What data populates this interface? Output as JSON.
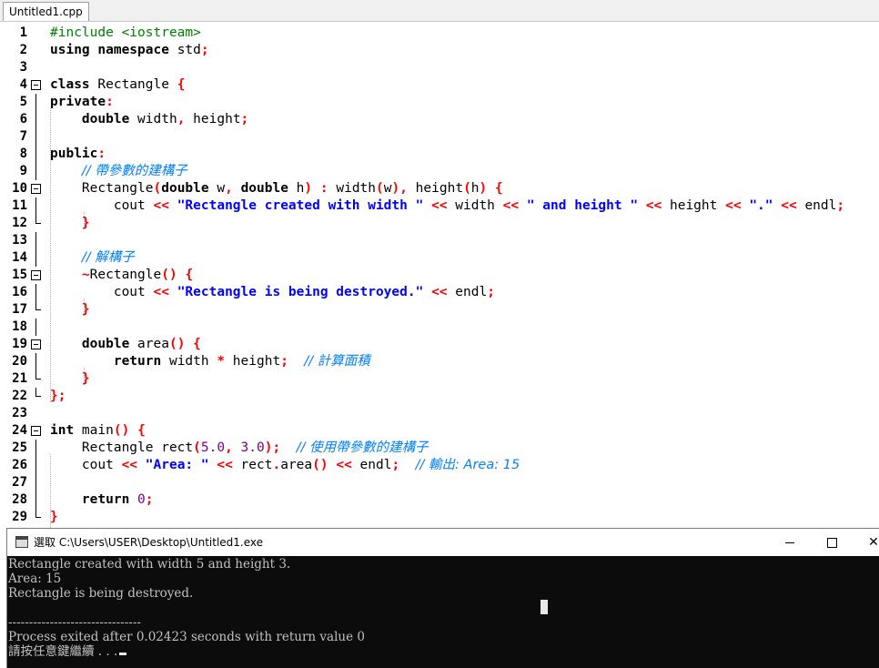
{
  "tab": {
    "label": "Untitled1.cpp"
  },
  "editor": {
    "lines": [
      {
        "n": "1",
        "tokens": [
          [
            "pp",
            "#include <iostream>"
          ]
        ]
      },
      {
        "n": "2",
        "tokens": [
          [
            "kw",
            "using"
          ],
          [
            "tx",
            " "
          ],
          [
            "kw",
            "namespace"
          ],
          [
            "tx",
            " std"
          ],
          [
            "sy",
            ";"
          ]
        ]
      },
      {
        "n": "3",
        "tokens": []
      },
      {
        "n": "4",
        "tokens": [
          [
            "kw",
            "class"
          ],
          [
            "tx",
            " Rectangle "
          ],
          [
            "sy",
            "{"
          ]
        ]
      },
      {
        "n": "5",
        "tokens": [
          [
            "kw",
            "private"
          ],
          [
            "sy",
            ":"
          ]
        ]
      },
      {
        "n": "6",
        "tokens": [
          [
            "tx",
            "    "
          ],
          [
            "kw",
            "double"
          ],
          [
            "tx",
            " width"
          ],
          [
            "sy",
            ","
          ],
          [
            "tx",
            " height"
          ],
          [
            "sy",
            ";"
          ]
        ]
      },
      {
        "n": "7",
        "tokens": []
      },
      {
        "n": "8",
        "tokens": [
          [
            "kw",
            "public"
          ],
          [
            "sy",
            ":"
          ]
        ]
      },
      {
        "n": "9",
        "tokens": [
          [
            "tx",
            "    "
          ],
          [
            "cm",
            "// 帶參數的建構子"
          ]
        ]
      },
      {
        "n": "10",
        "tokens": [
          [
            "tx",
            "    Rectangle"
          ],
          [
            "sy",
            "("
          ],
          [
            "kw",
            "double"
          ],
          [
            "tx",
            " w"
          ],
          [
            "sy",
            ","
          ],
          [
            "tx",
            " "
          ],
          [
            "kw",
            "double"
          ],
          [
            "tx",
            " h"
          ],
          [
            "sy",
            ")"
          ],
          [
            "tx",
            " "
          ],
          [
            "sy",
            ":"
          ],
          [
            "tx",
            " width"
          ],
          [
            "sy",
            "("
          ],
          [
            "tx",
            "w"
          ],
          [
            "sy",
            ")"
          ],
          [
            "sy",
            ","
          ],
          [
            "tx",
            " height"
          ],
          [
            "sy",
            "("
          ],
          [
            "tx",
            "h"
          ],
          [
            "sy",
            ")"
          ],
          [
            "tx",
            " "
          ],
          [
            "sy",
            "{"
          ]
        ]
      },
      {
        "n": "11",
        "tokens": [
          [
            "tx",
            "        cout "
          ],
          [
            "sy",
            "<<"
          ],
          [
            "tx",
            " "
          ],
          [
            "st",
            "\"Rectangle created with width \""
          ],
          [
            "tx",
            " "
          ],
          [
            "sy",
            "<<"
          ],
          [
            "tx",
            " width "
          ],
          [
            "sy",
            "<<"
          ],
          [
            "tx",
            " "
          ],
          [
            "st",
            "\" and height \""
          ],
          [
            "tx",
            " "
          ],
          [
            "sy",
            "<<"
          ],
          [
            "tx",
            " height "
          ],
          [
            "sy",
            "<<"
          ],
          [
            "tx",
            " "
          ],
          [
            "st",
            "\".\""
          ],
          [
            "tx",
            " "
          ],
          [
            "sy",
            "<<"
          ],
          [
            "tx",
            " endl"
          ],
          [
            "sy",
            ";"
          ]
        ]
      },
      {
        "n": "12",
        "tokens": [
          [
            "tx",
            "    "
          ],
          [
            "sy",
            "}"
          ]
        ]
      },
      {
        "n": "13",
        "tokens": []
      },
      {
        "n": "14",
        "tokens": [
          [
            "tx",
            "    "
          ],
          [
            "cm",
            "// 解構子"
          ]
        ]
      },
      {
        "n": "15",
        "tokens": [
          [
            "tx",
            "    "
          ],
          [
            "sy",
            "~"
          ],
          [
            "tx",
            "Rectangle"
          ],
          [
            "sy",
            "()"
          ],
          [
            "tx",
            " "
          ],
          [
            "sy",
            "{"
          ]
        ]
      },
      {
        "n": "16",
        "tokens": [
          [
            "tx",
            "        cout "
          ],
          [
            "sy",
            "<<"
          ],
          [
            "tx",
            " "
          ],
          [
            "st",
            "\"Rectangle is being destroyed.\""
          ],
          [
            "tx",
            " "
          ],
          [
            "sy",
            "<<"
          ],
          [
            "tx",
            " endl"
          ],
          [
            "sy",
            ";"
          ]
        ]
      },
      {
        "n": "17",
        "tokens": [
          [
            "tx",
            "    "
          ],
          [
            "sy",
            "}"
          ]
        ]
      },
      {
        "n": "18",
        "tokens": []
      },
      {
        "n": "19",
        "tokens": [
          [
            "tx",
            "    "
          ],
          [
            "kw",
            "double"
          ],
          [
            "tx",
            " area"
          ],
          [
            "sy",
            "()"
          ],
          [
            "tx",
            " "
          ],
          [
            "sy",
            "{"
          ]
        ]
      },
      {
        "n": "20",
        "tokens": [
          [
            "tx",
            "        "
          ],
          [
            "kw",
            "return"
          ],
          [
            "tx",
            " width "
          ],
          [
            "sy",
            "*"
          ],
          [
            "tx",
            " height"
          ],
          [
            "sy",
            ";"
          ],
          [
            "tx",
            "  "
          ],
          [
            "cm",
            "// 計算面積"
          ]
        ]
      },
      {
        "n": "21",
        "tokens": [
          [
            "tx",
            "    "
          ],
          [
            "sy",
            "}"
          ]
        ]
      },
      {
        "n": "22",
        "tokens": [
          [
            "sy",
            "};"
          ]
        ]
      },
      {
        "n": "23",
        "tokens": []
      },
      {
        "n": "24",
        "tokens": [
          [
            "kw",
            "int"
          ],
          [
            "tx",
            " main"
          ],
          [
            "sy",
            "()"
          ],
          [
            "tx",
            " "
          ],
          [
            "sy",
            "{"
          ]
        ]
      },
      {
        "n": "25",
        "tokens": [
          [
            "tx",
            "    Rectangle rect"
          ],
          [
            "sy",
            "("
          ],
          [
            "nm",
            "5.0"
          ],
          [
            "sy",
            ","
          ],
          [
            "tx",
            " "
          ],
          [
            "nm",
            "3.0"
          ],
          [
            "sy",
            ")"
          ],
          [
            "sy",
            ";"
          ],
          [
            "tx",
            "  "
          ],
          [
            "cm",
            "// 使用帶參數的建構子"
          ]
        ]
      },
      {
        "n": "26",
        "tokens": [
          [
            "tx",
            "    cout "
          ],
          [
            "sy",
            "<<"
          ],
          [
            "tx",
            " "
          ],
          [
            "st",
            "\"Area: \""
          ],
          [
            "tx",
            " "
          ],
          [
            "sy",
            "<<"
          ],
          [
            "tx",
            " rect"
          ],
          [
            "sy",
            "."
          ],
          [
            "tx",
            "area"
          ],
          [
            "sy",
            "()"
          ],
          [
            "tx",
            " "
          ],
          [
            "sy",
            "<<"
          ],
          [
            "tx",
            " endl"
          ],
          [
            "sy",
            ";"
          ],
          [
            "tx",
            "  "
          ],
          [
            "cm",
            "// 輸出: Area: 15"
          ]
        ]
      },
      {
        "n": "27",
        "tokens": []
      },
      {
        "n": "28",
        "tokens": [
          [
            "tx",
            "    "
          ],
          [
            "kw",
            "return"
          ],
          [
            "tx",
            " "
          ],
          [
            "nm",
            "0"
          ],
          [
            "sy",
            ";"
          ]
        ]
      },
      {
        "n": "29",
        "tokens": [
          [
            "sy",
            "}"
          ]
        ]
      }
    ]
  },
  "console": {
    "title": "選取 C:\\Users\\USER\\Desktop\\Untitled1.exe",
    "close_glyph": "✕",
    "output": [
      "Rectangle created with width 5 and height 3.",
      "Area: 15",
      "Rectangle is being destroyed.",
      "",
      "--------------------------------",
      "Process exited after 0.02423 seconds with return value 0",
      "請按任意鍵繼續 . . ."
    ]
  }
}
